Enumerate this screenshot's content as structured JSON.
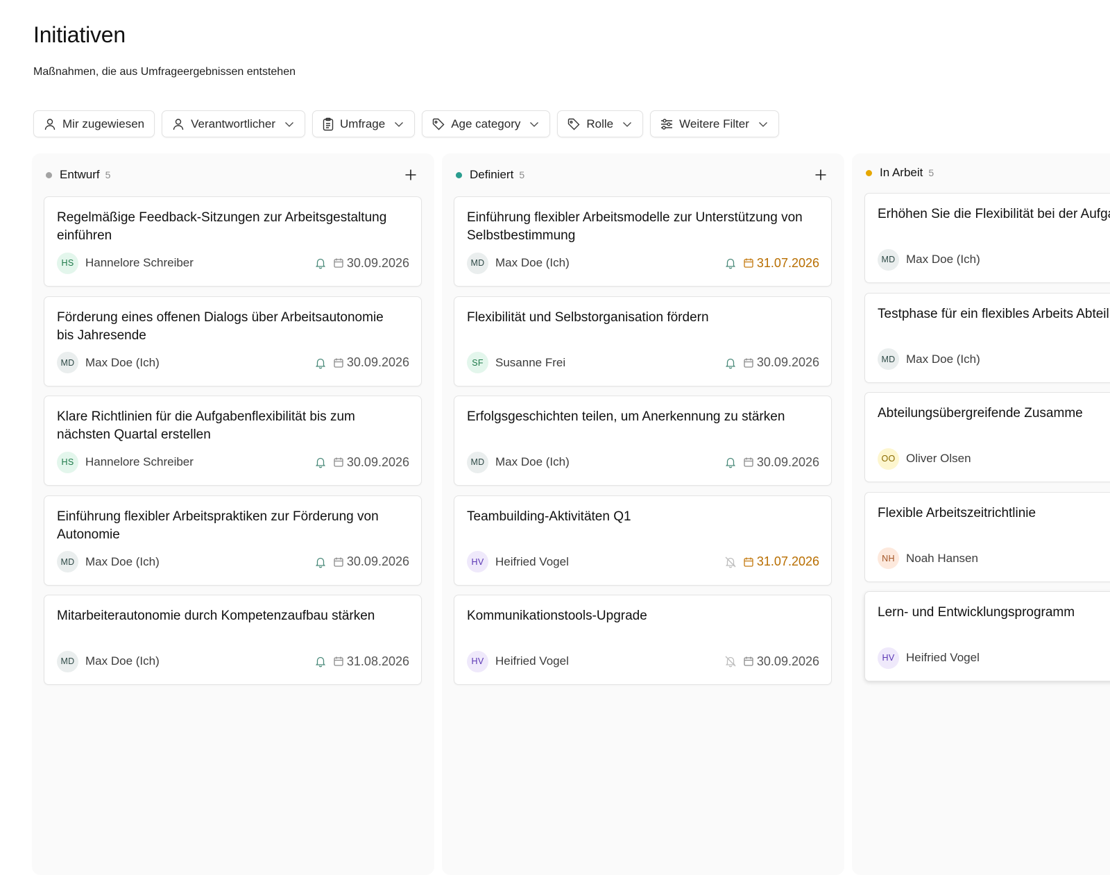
{
  "page": {
    "title": "Initiativen",
    "subtitle": "Maßnahmen, die aus Umfrageergebnissen entstehen"
  },
  "filters": [
    {
      "label": "Mir zugewiesen",
      "icon": "user-icon",
      "dropdown": false
    },
    {
      "label": "Verantwortlicher",
      "icon": "user-icon",
      "dropdown": true
    },
    {
      "label": "Umfrage",
      "icon": "clipboard-icon",
      "dropdown": true
    },
    {
      "label": "Age category",
      "icon": "tag-icon",
      "dropdown": true
    },
    {
      "label": "Rolle",
      "icon": "tag-icon",
      "dropdown": true
    },
    {
      "label": "Weitere Filter",
      "icon": "sliders-icon",
      "dropdown": true
    }
  ],
  "colors": {
    "entwurf": "#a3a3a3",
    "definiert": "#2a9d8f",
    "in_arbeit": "#e6a700",
    "warning_date": "#b86e00"
  },
  "columns": [
    {
      "title": "Entwurf",
      "count": "5",
      "cards": [
        {
          "title": "Regelmäßige Feedback-Sitzungen zur Arbeitsgestaltung einführen",
          "initials": "HS",
          "assignee": "Hannelore Schreiber",
          "date": "30.09.2026",
          "reminder": true,
          "overdue": false
        },
        {
          "title": "Förderung eines offenen Dialogs über Arbeitsautonomie bis Jahresende",
          "initials": "MD",
          "assignee": "Max Doe (Ich)",
          "date": "30.09.2026",
          "reminder": true,
          "overdue": false
        },
        {
          "title": "Klare Richtlinien für die Aufgabenflexibilität bis zum nächsten Quartal erstellen",
          "initials": "HS",
          "assignee": "Hannelore Schreiber",
          "date": "30.09.2026",
          "reminder": true,
          "overdue": false
        },
        {
          "title": "Einführung flexibler Arbeitspraktiken zur Förderung von Autonomie",
          "initials": "MD",
          "assignee": "Max Doe (Ich)",
          "date": "30.09.2026",
          "reminder": true,
          "overdue": false
        },
        {
          "title": "Mitarbeiterautonomie durch Kompetenzaufbau stärken",
          "initials": "MD",
          "assignee": "Max Doe (Ich)",
          "date": "31.08.2026",
          "reminder": true,
          "overdue": false
        }
      ]
    },
    {
      "title": "Definiert",
      "count": "5",
      "cards": [
        {
          "title": "Einführung flexibler Arbeitsmodelle zur Unterstützung von Selbstbestimmung",
          "initials": "MD",
          "assignee": "Max Doe (Ich)",
          "date": "31.07.2026",
          "reminder": true,
          "overdue": true
        },
        {
          "title": "Flexibilität und Selbstorganisation fördern",
          "initials": "SF",
          "assignee": "Susanne Frei",
          "date": "30.09.2026",
          "reminder": true,
          "overdue": false
        },
        {
          "title": "Erfolgsgeschichten teilen, um Anerkennung zu stärken",
          "initials": "MD",
          "assignee": "Max Doe (Ich)",
          "date": "30.09.2026",
          "reminder": true,
          "overdue": false
        },
        {
          "title": "Teambuilding-Aktivitäten Q1",
          "initials": "HV",
          "assignee": "Heifried Vogel",
          "date": "31.07.2026",
          "reminder": false,
          "overdue": true
        },
        {
          "title": "Kommunikationstools-Upgrade",
          "initials": "HV",
          "assignee": "Heifried Vogel",
          "date": "30.09.2026",
          "reminder": false,
          "overdue": false
        }
      ]
    },
    {
      "title": "In Arbeit",
      "count": "5",
      "cards": [
        {
          "title": "Erhöhen Sie die Flexibilität bei der Aufgabenbearbeitung innerhalb vo",
          "initials": "MD",
          "assignee": "Max Doe (Ich)"
        },
        {
          "title": "Testphase für ein flexibles Arbeits Abteilung innerhalb von drei Mona",
          "initials": "MD",
          "assignee": "Max Doe (Ich)"
        },
        {
          "title": "Abteilungsübergreifende Zusamme",
          "initials": "OO",
          "assignee": "Oliver Olsen"
        },
        {
          "title": "Flexible Arbeitszeitrichtlinie",
          "initials": "NH",
          "assignee": "Noah Hansen"
        },
        {
          "title": "Lern- und Entwicklungsprogramm",
          "initials": "HV",
          "assignee": "Heifried Vogel"
        }
      ]
    }
  ]
}
